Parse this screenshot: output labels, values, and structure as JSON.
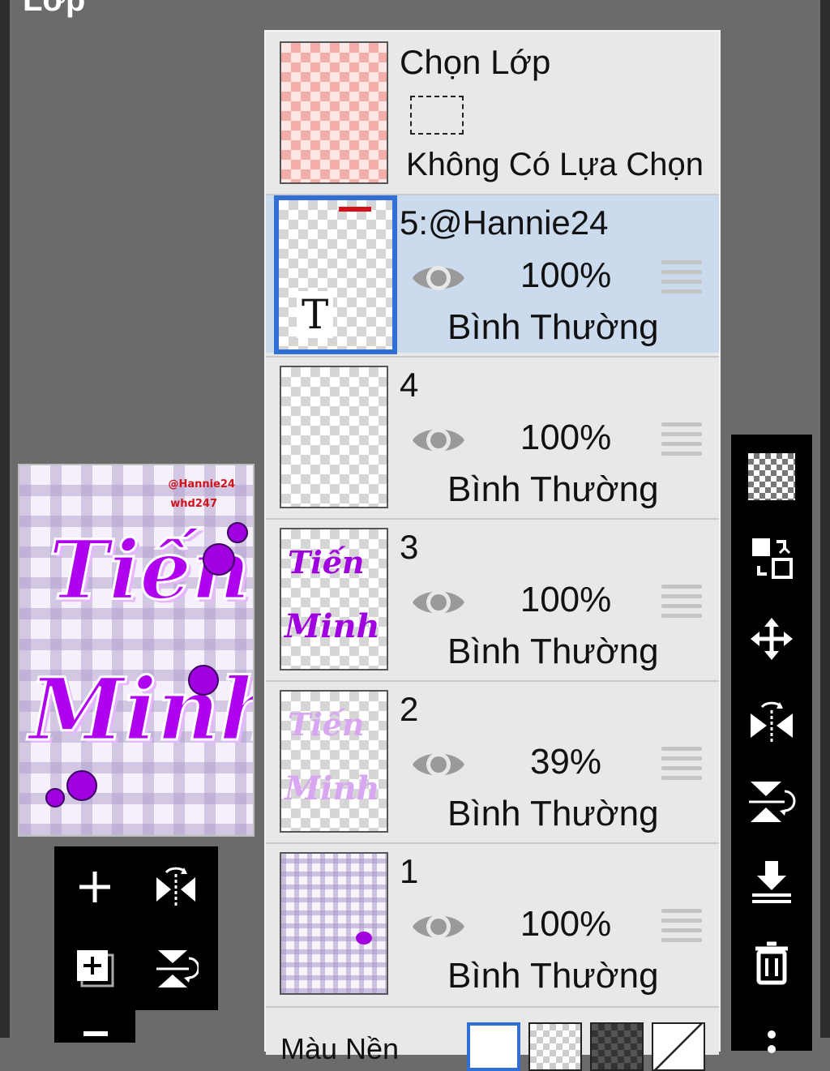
{
  "header": {
    "title": "Lớp"
  },
  "selection_layer": {
    "title": "Chọn Lớp",
    "status": "Không Có Lựa Chọn"
  },
  "layers": [
    {
      "name": "5:@Hannie24",
      "opacity": "100%",
      "blend_mode": "Bình Thường",
      "active": true,
      "thumb_glyph": "T"
    },
    {
      "name": "4",
      "opacity": "100%",
      "blend_mode": "Bình Thường",
      "active": false
    },
    {
      "name": "3",
      "opacity": "100%",
      "blend_mode": "Bình Thường",
      "active": false
    },
    {
      "name": "2",
      "opacity": "39%",
      "blend_mode": "Bình Thường",
      "active": false
    },
    {
      "name": "1",
      "opacity": "100%",
      "blend_mode": "Bình Thường",
      "active": false
    }
  ],
  "background": {
    "label": "Màu Nền"
  },
  "preview": {
    "credit_line1": "@Hannie24",
    "credit_line2": "whd247",
    "word1": "Tiến",
    "word2": "Minh"
  },
  "left_tools": {
    "add": "add-layer-icon",
    "flip_h": "flip-horizontal-icon",
    "add_copy": "add-copy-layer-icon",
    "flip_v": "flip-vertical-icon"
  },
  "right_tools": [
    "transparency-icon",
    "swap-layer-icon",
    "move-icon",
    "flip-horizontal-icon",
    "flip-vertical-icon",
    "merge-down-icon",
    "trash-icon",
    "more-icon"
  ],
  "colors": {
    "active_row": "#ccdaee",
    "active_border": "#2f6fd6",
    "accent_purple": "#b000f0"
  }
}
